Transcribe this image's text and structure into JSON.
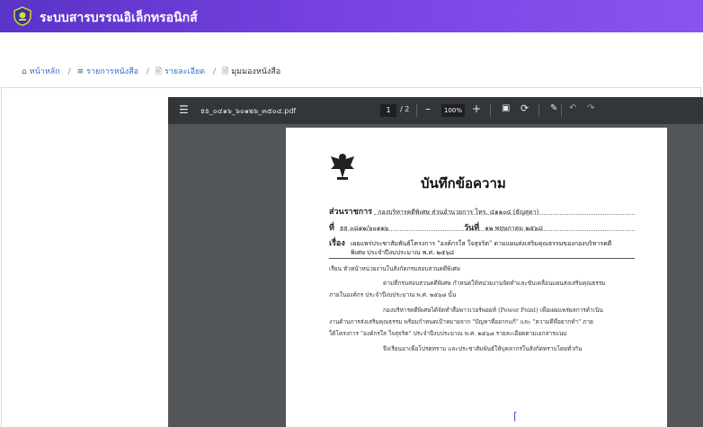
{
  "app": {
    "title": "ระบบสารบรรณอิเล็กทรอนิกส์"
  },
  "breadcrumb": {
    "home": "หน้าหลัก",
    "list": "รายการหนังสือ",
    "detail": "รายละเอียด",
    "preview": "มุมมองหนังสือ"
  },
  "viewer": {
    "filename": "ธธ_๐๔๑๖_๖๐๑๒๖_๓๕๐๔.pdf",
    "page_current": "1",
    "page_total": "/ 2",
    "zoom": "100%"
  },
  "document": {
    "title": "บันทึกข้อความ",
    "agency_label": "ส่วนราชการ",
    "agency_value": "กองบริหารคดีพิเศษ ส่วนอำนวยการ โทร. ๔๑๑๐๔ (ธัญสุดา)",
    "ref_label": "ที่",
    "ref_value": "ธธ ๐๘๑๒/๖๐๑๒๖",
    "date_label": "วันที่",
    "date_value": "๑๒ พฤษภาคม ๒๕๖๘",
    "subject_label": "เรื่อง",
    "subject_line1": "เผยแพร่ประชาสัมพันธ์โครงการ \"องค์กรใส ใจสุจริต\" ตามแผนส่งเสริมคุณธรรมของกองบริหารคดี",
    "subject_line2": "พิเศษ ประจำปีงบประมาณ พ.ศ. ๒๕๖๘",
    "to_line": "เรียน   หัวหน้าหน่วยงานในสังกัดกรมสอบสวนคดีพิเศษ",
    "para1_line1": "ตามที่กรมสอบสวนคดีพิเศษ กำหนดให้หน่วยงานจัดทำและขับเคลื่อนแผนส่งเสริมคุณธรรม",
    "para1_line2": "ภายในองค์กร ประจำปีงบประมาณ พ.ศ. ๒๕๖๘ นั้น",
    "para2_line1": "กองบริหารคดีพิเศษได้จัดทำสื่อพาวเวอร์พอยท์ (Power Point) เพื่อเผยแพร่ผลการดำเนิน",
    "para2_line2": "งานด้านการส่งเสริมคุณธรรม พร้อมกำหนดเป้าหมายจาก \"ปัญหาที่อยากแก้\" และ \"ความดีที่อยากทำ\" ภาย",
    "para2_line3": "ใต้โครงการ \"องค์กรใส ใจสุจริต\" ประจำปีงบประมาณ พ.ศ. ๒๕๖๘ รายละเอียดตามเอกสารแนบ",
    "closing": "จึงเรียนมาเพื่อโปรดทราบ และประชาสัมพันธ์ให้บุคลากรในสังกัดทราบโดยทั่วกัน"
  },
  "icons": {
    "home": "home-icon",
    "list": "list-icon",
    "file": "file-icon",
    "preview": "document-preview-icon"
  },
  "colors": {
    "header_start": "#5a33c8",
    "header_end": "#8b53ee",
    "viewer_bg": "#525659",
    "toolbar_bg": "#323639"
  }
}
